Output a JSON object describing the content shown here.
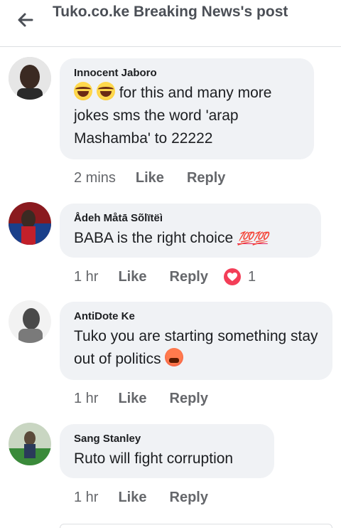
{
  "header": {
    "title": "Tuko.co.ke Breaking News's post"
  },
  "comments": [
    {
      "author": "Innocent Jaboro",
      "text": "for this and many more jokes sms the word 'arap Mashamba' to 22222",
      "time": "2 mins",
      "like": "Like",
      "reply": "Reply"
    },
    {
      "author": "Ådeh Måtā Sõlïtëì",
      "text": "BABA is the right choice",
      "emoji_text": "💯💯",
      "time": "1 hr",
      "like": "Like",
      "reply": "Reply",
      "reaction_count": "1"
    },
    {
      "author": "AntiDote Ke",
      "text": "Tuko you are starting something stay out of politics",
      "time": "1 hr",
      "like": "Like",
      "reply": "Reply"
    },
    {
      "author": "Sang Stanley",
      "text": "Ruto will fight corruption",
      "time": "1 hr",
      "like": "Like",
      "reply": "Reply"
    }
  ],
  "colors": {
    "bubble": "#f0f2f5",
    "meta": "#65676b",
    "love": "#f33e58"
  },
  "icons": [
    "arrow-left-icon",
    "laugh-emoji-icon",
    "hundred-emoji-icon",
    "angry-emoji-icon",
    "heart-reaction-icon"
  ]
}
